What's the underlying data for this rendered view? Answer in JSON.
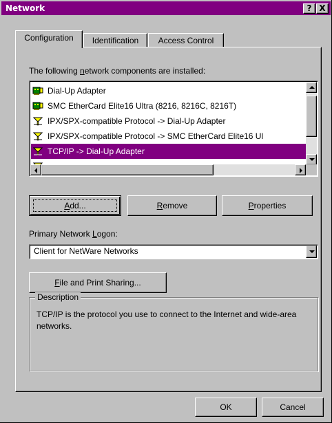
{
  "window": {
    "title": "Network",
    "help_button": "?",
    "close_button": "X"
  },
  "tabs": [
    {
      "label": "Configuration",
      "active": true
    },
    {
      "label": "Identification",
      "active": false
    },
    {
      "label": "Access Control",
      "active": false
    }
  ],
  "components": {
    "heading_pre": "The following ",
    "heading_mnemonic": "n",
    "heading_post": "etwork components are installed:",
    "items": [
      {
        "label": "Dial-Up Adapter",
        "icon": "network-adapter-icon",
        "selected": false
      },
      {
        "label": "SMC EtherCard Elite16 Ultra (8216, 8216C, 8216T)",
        "icon": "network-adapter-icon",
        "selected": false
      },
      {
        "label": "IPX/SPX-compatible Protocol -> Dial-Up Adapter",
        "icon": "protocol-icon",
        "selected": false
      },
      {
        "label": "IPX/SPX-compatible Protocol -> SMC EtherCard Elite16 Ul",
        "icon": "protocol-icon",
        "selected": false
      },
      {
        "label": "TCP/IP -> Dial-Up Adapter",
        "icon": "protocol-icon",
        "selected": true
      }
    ]
  },
  "buttons": {
    "add_mnemonic": "A",
    "add_rest": "dd...",
    "remove_mnemonic": "R",
    "remove_rest": "emove",
    "properties_mnemonic": "P",
    "properties_rest": "roperties",
    "file_sharing_mnemonic": "F",
    "file_sharing_rest": "ile and Print Sharing...",
    "ok": "OK",
    "cancel": "Cancel"
  },
  "logon": {
    "label_pre": "Primary Network ",
    "label_mnemonic": "L",
    "label_post": "ogon:",
    "value": "Client for NetWare Networks"
  },
  "description": {
    "title": "Description",
    "text": "TCP/IP is the protocol you use to connect to the Internet and wide-area networks."
  },
  "colors": {
    "titlebar": "#800080",
    "selection": "#800080",
    "face": "#c0c0c0"
  }
}
